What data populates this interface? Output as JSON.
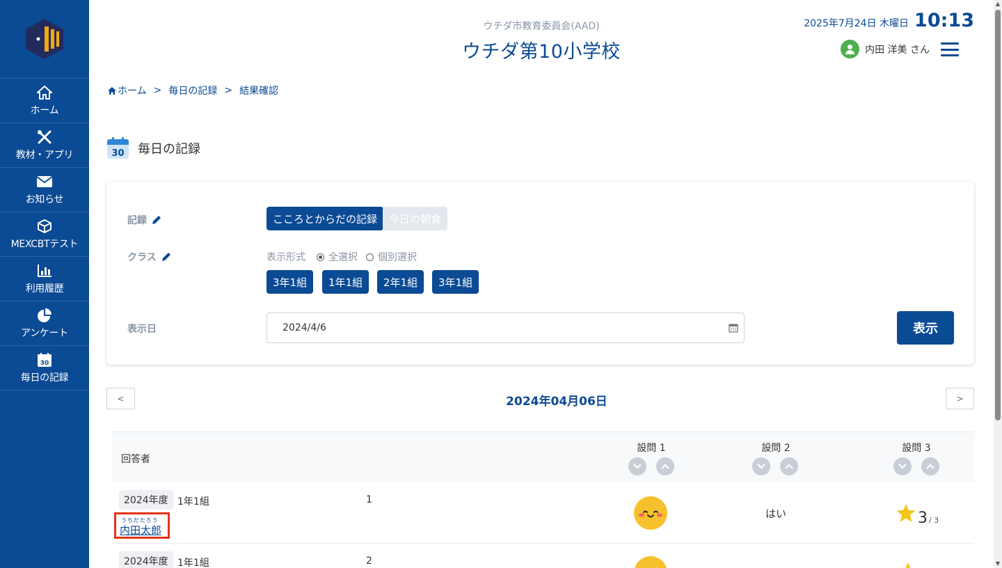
{
  "sidebar": {
    "items": [
      {
        "label": "ホーム",
        "icon": "home-icon"
      },
      {
        "label": "教材・アプリ",
        "icon": "tools-icon"
      },
      {
        "label": "お知らせ",
        "icon": "mail-icon"
      },
      {
        "label": "MEXCBTテスト",
        "icon": "cube-icon"
      },
      {
        "label": "利用履歴",
        "icon": "bar-chart-icon"
      },
      {
        "label": "アンケート",
        "icon": "pie-chart-icon"
      },
      {
        "label": "毎日の記録",
        "icon": "calendar-icon"
      }
    ]
  },
  "header": {
    "org": "ウチダ市教育委員会(AAD)",
    "school": "ウチダ第10小学校",
    "date": "2025年7月24日 木曜日",
    "time": "10:13",
    "user": "内田 洋美 さん"
  },
  "breadcrumb": {
    "home": "ホーム",
    "sep": ">",
    "daily": "毎日の記録",
    "result": "結果確認"
  },
  "page": {
    "title": "毎日の記録",
    "calendar_day": "30"
  },
  "filters": {
    "record_label": "記録",
    "record_options": [
      "こころとからだの記録",
      "今日の朝食"
    ],
    "class_label": "クラス",
    "display_format_label": "表示形式",
    "radio_all": "全選択",
    "radio_individual": "個別選択",
    "classes": [
      "3年1組",
      "1年1組",
      "2年1組",
      "3年1組"
    ],
    "date_label": "表示日",
    "date_value": "2024/4/6",
    "show_button": "表示"
  },
  "date_nav": {
    "prev": "<",
    "next": ">",
    "current": "2024年04月06日"
  },
  "table": {
    "respondent_header": "回答者",
    "questions": [
      "設問 1",
      "設問 2",
      "設問 3"
    ],
    "rows": [
      {
        "year": "2024年度",
        "class": "1年1組",
        "number": "1",
        "furigana": "うちだたろう",
        "name": "内田太郎",
        "q1": "smiley",
        "q2": "はい",
        "q3_score": "3",
        "q3_max": "/ 3"
      },
      {
        "year": "2024年度",
        "class": "1年1組",
        "number": "2"
      }
    ]
  },
  "colors": {
    "primary": "#0b4a94",
    "highlight": "#e53317",
    "star": "#f5c518",
    "smiley": "#f7c12e"
  }
}
